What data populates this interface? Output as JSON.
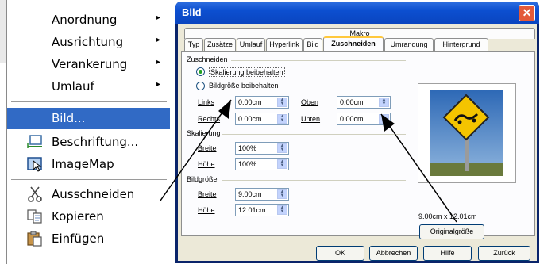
{
  "context_menu": {
    "items": [
      {
        "label": "Anordnung",
        "has_submenu": true,
        "icon": ""
      },
      {
        "label": "Ausrichtung",
        "has_submenu": true,
        "icon": ""
      },
      {
        "label": "Verankerung",
        "has_submenu": true,
        "icon": ""
      },
      {
        "label": "Umlauf",
        "has_submenu": true,
        "icon": ""
      },
      {
        "label": "Bild...",
        "has_submenu": false,
        "icon": ""
      },
      {
        "label": "Beschriftung...",
        "has_submenu": false,
        "icon": "caption-icon"
      },
      {
        "label": "ImageMap",
        "has_submenu": false,
        "icon": "imagemap-icon"
      },
      {
        "label": "Ausschneiden",
        "has_submenu": false,
        "icon": "scissors-icon"
      },
      {
        "label": "Kopieren",
        "has_submenu": false,
        "icon": "copy-icon"
      },
      {
        "label": "Einfügen",
        "has_submenu": false,
        "icon": "paste-icon"
      }
    ],
    "selected_index": 4,
    "submenu_arrow": "▸"
  },
  "dialog": {
    "title": "Bild",
    "close_label": "✕",
    "top_tab": "Makro",
    "tabs": [
      "Typ",
      "Zusätze",
      "Umlauf",
      "Hyperlink",
      "Bild",
      "Zuschneiden",
      "Umrandung",
      "Hintergrund"
    ],
    "active_tab": "Zuschneiden",
    "crop": {
      "group_label": "Zuschneiden",
      "option_keep_scale": "Skalierung beibehalten",
      "option_keep_size": "Bildgröße beibehalten",
      "left_label": "Links",
      "left_value": "0.00cm",
      "right_label": "Rechts",
      "right_value": "0.00cm",
      "top_label": "Oben",
      "top_value": "0.00cm",
      "bottom_label": "Unten",
      "bottom_value": "0.00cm"
    },
    "scale": {
      "group_label": "Skalierung",
      "width_label": "Breite",
      "width_value": "100%",
      "height_label": "Höhe",
      "height_value": "100%"
    },
    "size": {
      "group_label": "Bildgröße",
      "width_label": "Breite",
      "width_value": "9.00cm",
      "height_label": "Höhe",
      "height_value": "12.01cm"
    },
    "preview_dimensions": "9.00cm x 12.01cm",
    "original_size_button": "Originalgröße",
    "buttons": {
      "ok": "OK",
      "cancel": "Abbrechen",
      "help": "Hilfe",
      "back": "Zurück"
    }
  },
  "colors": {
    "selection": "#316ac5",
    "title_bar": "#0c4fd0",
    "sign_yellow": "#f4c400"
  }
}
